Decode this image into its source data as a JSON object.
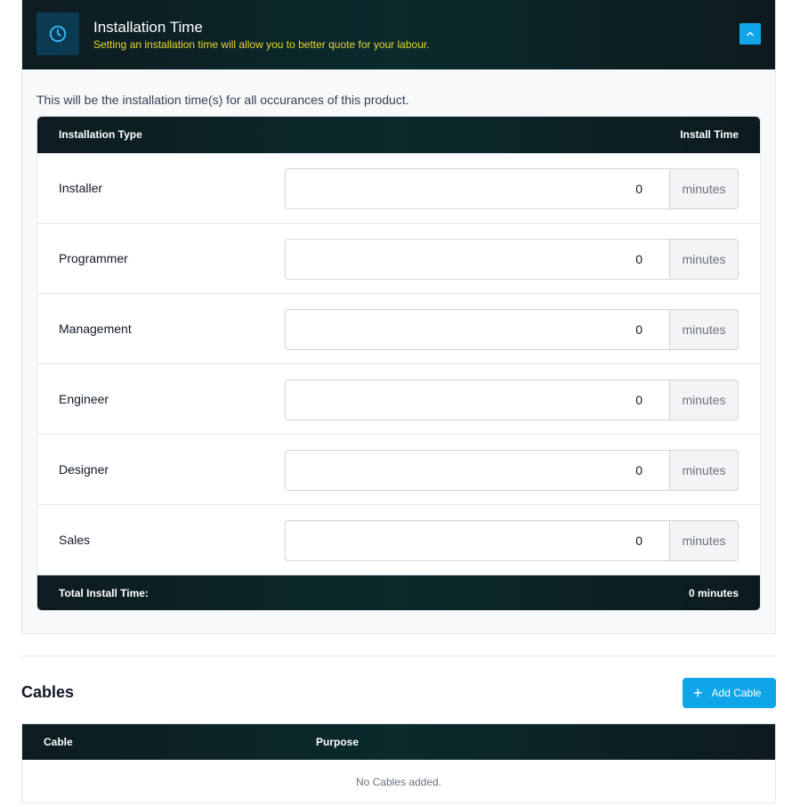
{
  "installation_panel": {
    "title": "Installation Time",
    "subtitle": "Setting an installation time will allow you to better quote for your labour.",
    "header_icon": "clock-icon",
    "collapse_icon": "chevron-up-icon",
    "intro": "This will be the installation time(s) for all occurances of this product.",
    "table": {
      "col_type": "Installation Type",
      "col_time": "Install Time",
      "unit": "minutes",
      "rows": [
        {
          "label": "Installer",
          "value": "0"
        },
        {
          "label": "Programmer",
          "value": "0"
        },
        {
          "label": "Management",
          "value": "0"
        },
        {
          "label": "Engineer",
          "value": "0"
        },
        {
          "label": "Designer",
          "value": "0"
        },
        {
          "label": "Sales",
          "value": "0"
        }
      ],
      "total_label": "Total Install Time:",
      "total_value": "0 minutes"
    }
  },
  "cables": {
    "title": "Cables",
    "add_label": "Add Cable",
    "add_icon": "plus-icon",
    "col_cable": "Cable",
    "col_purpose": "Purpose",
    "empty": "No Cables added."
  },
  "colors": {
    "accent": "#0ea5e9",
    "header_dark": "#0d1c21",
    "subtitle_yellow": "#e8d633"
  }
}
